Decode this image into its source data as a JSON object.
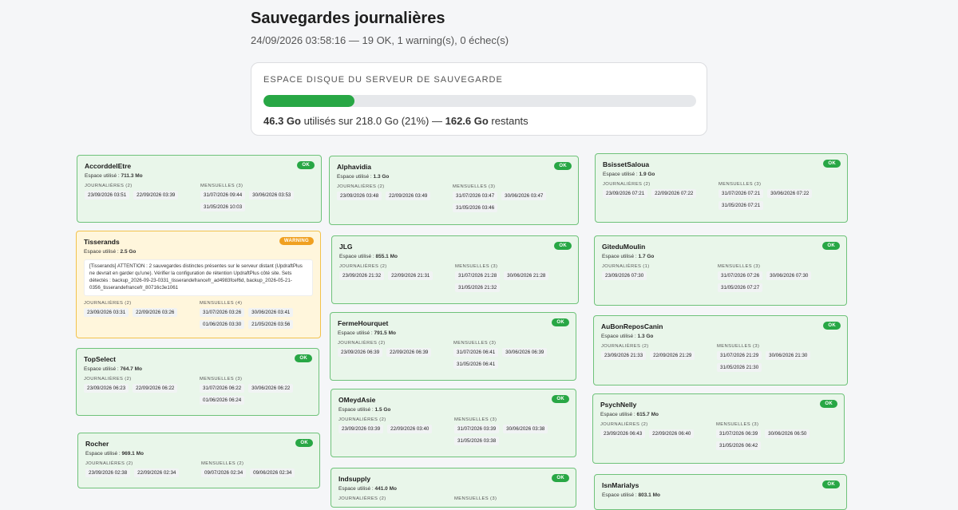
{
  "header": {
    "title": "Sauvegardes journalières",
    "summary": "24/09/2026 03:58:16 — 19 OK, 1 warning(s), 0 échec(s)"
  },
  "disk": {
    "label": "ESPACE DISQUE DU SERVEUR DE SAUVEGARDE",
    "used": "46.3 Go",
    "middle": " utilisés sur 218.0 Go (21%) — ",
    "remaining": "162.6 Go",
    "suffix": " restants",
    "used_fraction": 0.21,
    "bar_color": "#28a745"
  },
  "labels": {
    "usage_prefix": "Espace utilisé : "
  },
  "colors": {
    "ok": "#28a745",
    "warning": "#f0a020",
    "card_ok_bg": "#e9f6ea",
    "card_warn_bg": "#fff6dc"
  },
  "cards": [
    {
      "name": "AccorddelEtre",
      "status": "OK",
      "usage": "711.3 Mo",
      "daily_title": "JOURNALIÈRES (2)",
      "daily": [
        "23/09/2026 03:51",
        "22/09/2026 03:39"
      ],
      "monthly_title": "MENSUELLES (3)",
      "monthly": [
        "31/07/2026 09:44",
        "30/06/2026 03:53",
        "31/05/2026 10:03"
      ]
    },
    {
      "name": "Tisserands",
      "status": "WARNING",
      "usage": "2.5 Go",
      "message": "[Tisserands] ATTENTION : 2 sauvegardes distinctes présentes sur le serveur distant (UpdraftPlus ne devrait en garder qu'une). Vérifier la configuration de rétention UpdraftPlus côté site. Sets détectés : backup_2026-09-23-0331_tisserandefrancefr_ad4983fcef6d, backup_2026-05-21-0356_tisserandefrancefr_80716c3e1061",
      "daily_title": "JOURNALIÈRES (2)",
      "daily": [
        "23/09/2026 03:31",
        "22/09/2026 03:26"
      ],
      "monthly_title": "MENSUELLES (4)",
      "monthly": [
        "31/07/2026 03:26",
        "30/06/2026 03:41",
        "01/06/2026 03:30",
        "21/05/2026 03:56"
      ]
    },
    {
      "name": "TopSelect",
      "status": "OK",
      "usage": "764.7 Mo",
      "daily_title": "JOURNALIÈRES (2)",
      "daily": [
        "23/09/2026 06:23",
        "22/09/2026 06:22"
      ],
      "monthly_title": "MENSUELLES (3)",
      "monthly": [
        "31/07/2026 06:22",
        "30/06/2026 06:22",
        "01/06/2026 06:24"
      ]
    },
    {
      "name": "Rocher",
      "status": "OK",
      "usage": "969.1 Mo",
      "daily_title": "JOURNALIÈRES (2)",
      "daily": [
        "23/09/2026 02:38",
        "22/09/2026 02:34"
      ],
      "monthly_title": "MENSUELLES (2)",
      "monthly": [
        "09/07/2026 02:34",
        "09/06/2026 02:34"
      ]
    },
    {
      "name": "Alphavidia",
      "status": "OK",
      "usage": "1.3 Go",
      "daily_title": "JOURNALIÈRES (2)",
      "daily": [
        "23/09/2026 03:48",
        "22/09/2026 03:49"
      ],
      "monthly_title": "MENSUELLES (3)",
      "monthly": [
        "31/07/2026 03:47",
        "30/06/2026 03:47",
        "31/05/2026 03:46"
      ]
    },
    {
      "name": "JLG",
      "status": "OK",
      "usage": "855.1 Mo",
      "daily_title": "JOURNALIÈRES (2)",
      "daily": [
        "23/09/2026 21:32",
        "22/09/2026 21:31"
      ],
      "monthly_title": "MENSUELLES (3)",
      "monthly": [
        "31/07/2026 21:28",
        "30/06/2026 21:28",
        "31/05/2026 21:32"
      ]
    },
    {
      "name": "FermeHourquet",
      "status": "OK",
      "usage": "791.5 Mo",
      "daily_title": "JOURNALIÈRES (2)",
      "daily": [
        "23/09/2026 06:39",
        "22/09/2026 06:39"
      ],
      "monthly_title": "MENSUELLES (3)",
      "monthly": [
        "31/07/2026 06:41",
        "30/06/2026 06:39",
        "31/05/2026 06:41"
      ]
    },
    {
      "name": "OMeydAsie",
      "status": "OK",
      "usage": "1.5 Go",
      "daily_title": "JOURNALIÈRES (2)",
      "daily": [
        "23/09/2026 03:39",
        "22/09/2026 03:40"
      ],
      "monthly_title": "MENSUELLES (3)",
      "monthly": [
        "31/07/2026 03:39",
        "30/06/2026 03:38",
        "31/05/2026 03:38"
      ]
    },
    {
      "name": "Indsupply",
      "status": "OK",
      "usage": "441.0 Mo",
      "daily_title": "JOURNALIÈRES (2)",
      "daily": [],
      "monthly_title": "MENSUELLES (3)",
      "monthly": []
    },
    {
      "name": "BsissetSaloua",
      "status": "OK",
      "usage": "1.9 Go",
      "daily_title": "JOURNALIÈRES (2)",
      "daily": [
        "23/09/2026 07:21",
        "22/09/2026 07:22"
      ],
      "monthly_title": "MENSUELLES (3)",
      "monthly": [
        "31/07/2026 07:21",
        "30/06/2026 07:22",
        "31/05/2026 07:21"
      ]
    },
    {
      "name": "GiteduMoulin",
      "status": "OK",
      "usage": "1.7 Go",
      "daily_title": "JOURNALIÈRES (1)",
      "daily": [
        "23/09/2026 07:30"
      ],
      "monthly_title": "MENSUELLES (3)",
      "monthly": [
        "31/07/2026 07:26",
        "30/06/2026 07:30",
        "31/05/2026 07:27"
      ]
    },
    {
      "name": "AuBonReposCanin",
      "status": "OK",
      "usage": "1.3 Go",
      "daily_title": "JOURNALIÈRES (2)",
      "daily": [
        "23/09/2026 21:33",
        "22/09/2026 21:29"
      ],
      "monthly_title": "MENSUELLES (3)",
      "monthly": [
        "31/07/2026 21:29",
        "30/06/2026 21:30",
        "31/05/2026 21:30"
      ]
    },
    {
      "name": "PsychNelly",
      "status": "OK",
      "usage": "615.7 Mo",
      "daily_title": "JOURNALIÈRES (2)",
      "daily": [
        "23/09/2026 06:43",
        "22/09/2026 06:40"
      ],
      "monthly_title": "MENSUELLES (3)",
      "monthly": [
        "31/07/2026 06:39",
        "30/06/2026 06:50",
        "31/05/2026 06:42"
      ]
    },
    {
      "name": "IsnMarialys",
      "status": "OK",
      "usage": "803.1 Mo",
      "daily_title": "",
      "daily": [],
      "monthly_title": "",
      "monthly": []
    }
  ]
}
